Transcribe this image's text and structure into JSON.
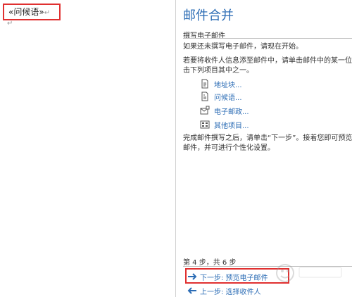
{
  "document": {
    "merge_field": "«问候语»",
    "paragraph_mark": "↵"
  },
  "pane": {
    "title": "邮件合并",
    "section_heading": "撰写电子邮件",
    "intro": "如果还未撰写电子邮件，请现在开始。",
    "instruction_lines": [
      "若要将收件人信息添至邮件中，请单击邮件中的某一位",
      "击下列项目其中之一。"
    ],
    "links": [
      {
        "label": "地址块...",
        "icon": "address-block-icon"
      },
      {
        "label": "问候语...",
        "icon": "greeting-line-icon"
      },
      {
        "label": "电子邮政...",
        "icon": "electronic-postage-icon"
      },
      {
        "label": "其他项目...",
        "icon": "more-items-icon"
      }
    ],
    "finish_lines": [
      "完成邮件撰写之后，请单击“下一步”。接着您即可预览",
      "邮件，并可进行个性化设置。"
    ],
    "step_count": "第 4 步，共 6 步",
    "next_step": "下一步: 预览电子邮件",
    "prev_step": "上一步: 选择收件人"
  },
  "colors": {
    "accent": "#2b6cb5",
    "highlight": "#e03030"
  }
}
